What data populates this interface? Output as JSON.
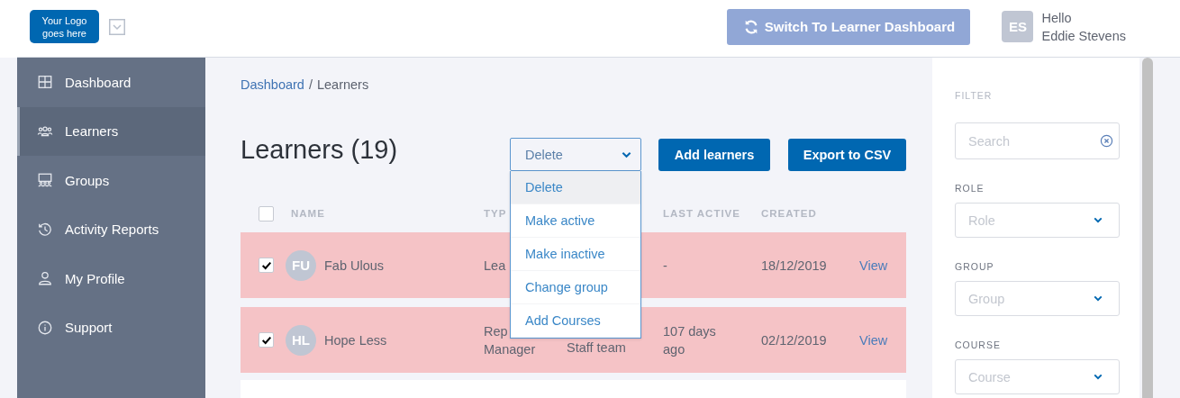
{
  "header": {
    "logo": "Your Logo goes here",
    "switch_button": "Switch To Learner Dashboard",
    "user": {
      "initials": "ES",
      "greeting": "Hello",
      "name": "Eddie Stevens"
    }
  },
  "sidebar": {
    "items": [
      {
        "label": "Dashboard",
        "kind": "grid",
        "selected": false
      },
      {
        "label": "Learners",
        "kind": "people",
        "selected": true
      },
      {
        "label": "Groups",
        "kind": "group",
        "selected": false
      },
      {
        "label": "Activity Reports",
        "kind": "history",
        "selected": false
      },
      {
        "label": "My Profile",
        "kind": "person",
        "selected": false
      },
      {
        "label": "Support",
        "kind": "info",
        "selected": false
      }
    ]
  },
  "breadcrumb": {
    "link": "Dashboard",
    "separator": "/",
    "current": "Learners"
  },
  "title": "Learners (19)",
  "bulk_action": {
    "value": "Delete",
    "expanded": true,
    "options": [
      {
        "label": "Delete",
        "selected": true
      },
      {
        "label": "Make active",
        "selected": false
      },
      {
        "label": "Make inactive",
        "selected": false
      },
      {
        "label": "Change group",
        "selected": false
      },
      {
        "label": "Add Courses",
        "selected": false
      }
    ]
  },
  "buttons": [
    "Add learners",
    "Export to CSV"
  ],
  "table": {
    "all_checked": false,
    "columns": {
      "name": "NAME",
      "type": "TYP",
      "last_active": "LAST ACTIVE",
      "created": "CREATED"
    },
    "rows": [
      {
        "checked": true,
        "initials": "FU",
        "name": "Fab Ulous",
        "type": [
          "Lea"
        ],
        "last_active": "-",
        "created": "18/12/2019",
        "action": "View"
      },
      {
        "checked": true,
        "initials": "HL",
        "name": "Hope Less",
        "type": [
          "Rep",
          "Manager"
        ],
        "group": "Staff team",
        "last_active": "107 days ago",
        "created": "02/12/2019",
        "action": "View"
      }
    ]
  },
  "filters": {
    "title": "FILTER",
    "fields": [
      {
        "kind": "search",
        "placeholder": "Search"
      },
      {
        "kind": "select",
        "label": "ROLE",
        "placeholder": "Role"
      },
      {
        "kind": "select",
        "label": "GROUP",
        "placeholder": "Group"
      },
      {
        "kind": "select",
        "label": "COURSE",
        "placeholder": "Course"
      }
    ]
  }
}
